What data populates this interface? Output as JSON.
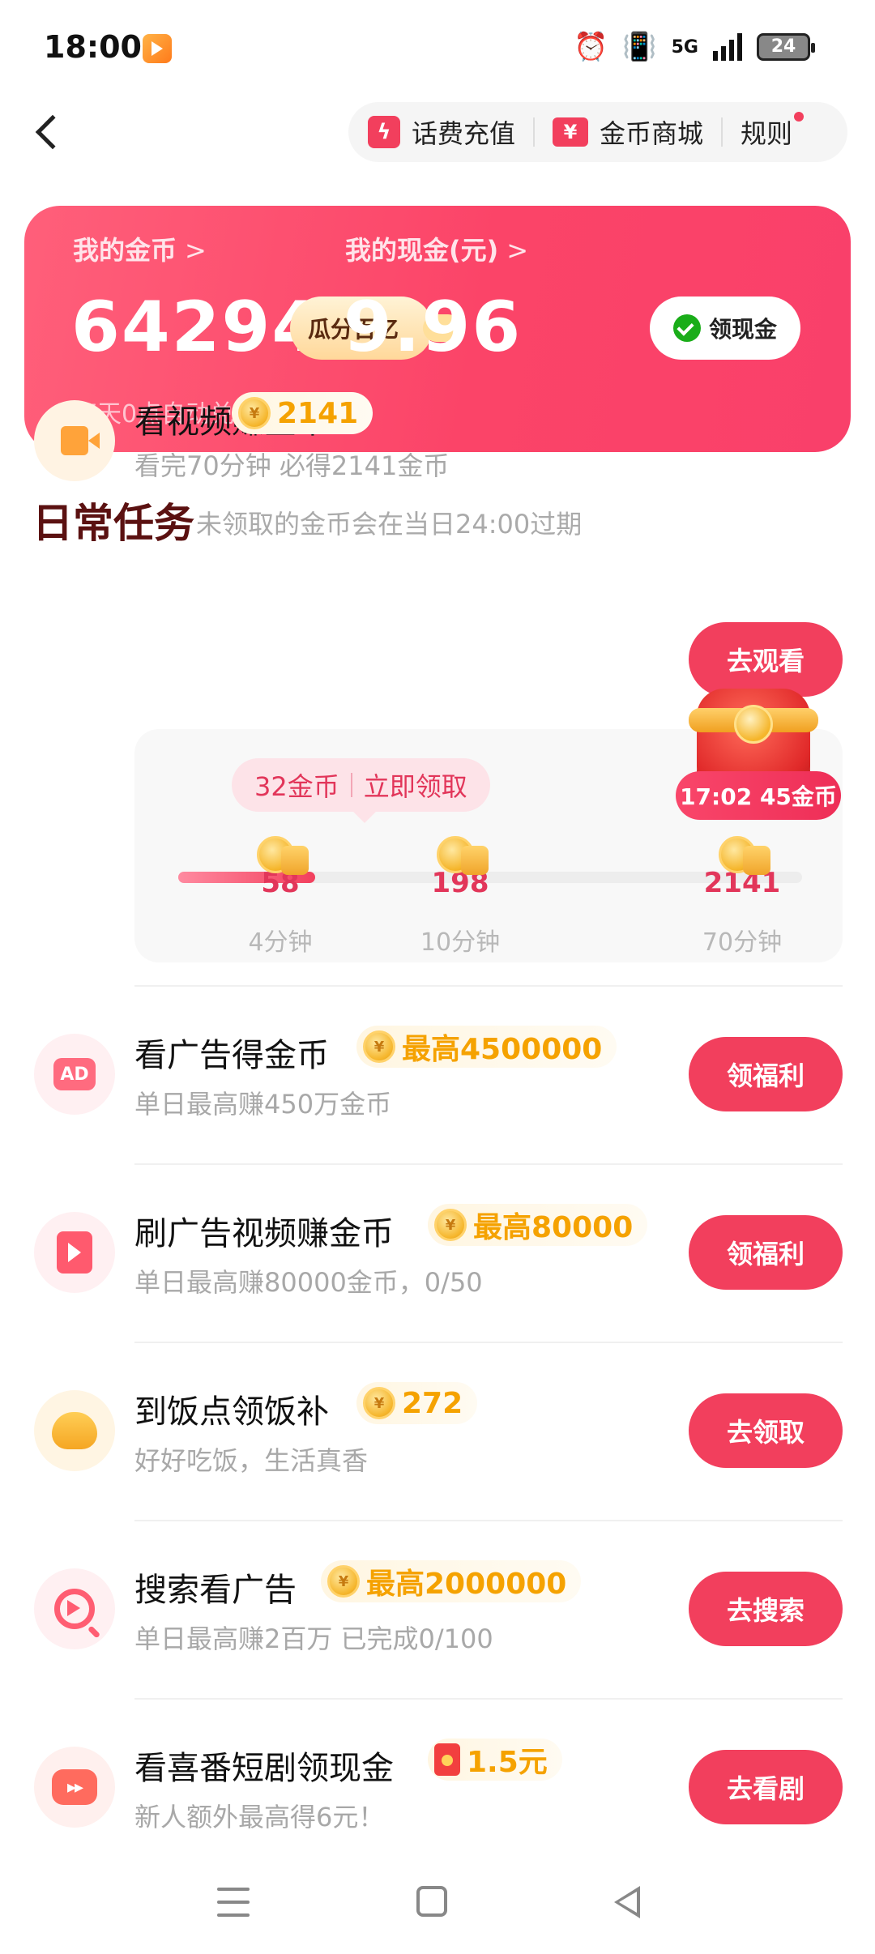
{
  "status_bar": {
    "time": "18:00",
    "network": "5G",
    "battery": "24"
  },
  "header": {
    "recharge_label": "话费充值",
    "mall_label": "金币商城",
    "rules_label": "规则"
  },
  "wallet": {
    "coins_label": "我的金币",
    "coins_value": "64294",
    "coins_pill": "瓜分百亿",
    "cash_label": "我的现金(元)",
    "cash_value": "9.96",
    "cash_button": "领现金",
    "note": "每天0点自动兑换成现金",
    "chevron": ">"
  },
  "daily": {
    "title": "日常任务",
    "subtitle": "未领取的金币会在当日24:00过期"
  },
  "tasks": [
    {
      "title": "看视频赚金币",
      "reward": "2141",
      "desc": "看完70分钟 必得2141金币",
      "button": "去观看"
    },
    {
      "title": "看广告得金币",
      "reward": "最高4500000",
      "desc": "单日最高赚450万金币",
      "button": "领福利"
    },
    {
      "title": "刷广告视频赚金币",
      "reward": "最高80000",
      "desc": "单日最高赚80000金币，0/50",
      "button": "领福利"
    },
    {
      "title": "到饭点领饭补",
      "reward": "272",
      "desc": "好好吃饭，生活真香",
      "button": "去领取"
    },
    {
      "title": "搜索看广告",
      "reward": "最高2000000",
      "desc": "单日最高赚2百万 已完成0/100",
      "button": "去搜索"
    },
    {
      "title": "看喜番短剧领现金",
      "reward": "1.5元",
      "desc": "新人额外最高得6元！",
      "button": "去看剧"
    }
  ],
  "video_progress": {
    "claim_amount": "32金币",
    "claim_action": "立即领取",
    "fill_fraction": 0.22,
    "nodes": [
      {
        "coins": "58",
        "time": "4分钟"
      },
      {
        "coins": "198",
        "time": "10分钟"
      },
      {
        "coins": "2141",
        "time": "70分钟"
      }
    ],
    "chest_label": "17:02 45金币"
  },
  "icons": {
    "back": "back-arrow-icon",
    "recharge": "lightning-icon",
    "mall": "yuan-ticket-icon",
    "coin": "gold-coin-icon",
    "wechat": "wechat-check-icon",
    "coin_symbol": "¥",
    "ad_text": "AD",
    "drama_text": "▸▸"
  },
  "colors": {
    "accent": "#f23f5d",
    "reward_text": "#f5a200",
    "title_dark_red": "#5b1111"
  }
}
